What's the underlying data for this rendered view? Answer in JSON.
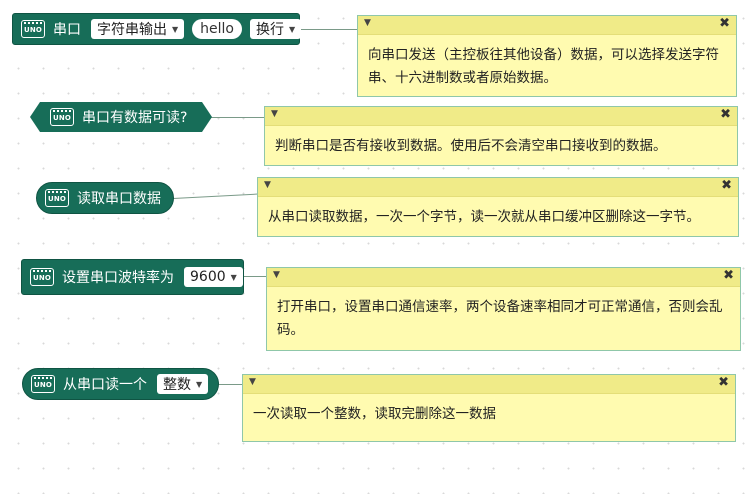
{
  "blocks": {
    "serial_write": {
      "label": "串口",
      "type_value": "字符串输出",
      "text_value": "hello",
      "ending_value": "换行"
    },
    "serial_available": {
      "label": "串口有数据可读?"
    },
    "serial_read": {
      "label": "读取串口数据"
    },
    "serial_begin": {
      "label": "设置串口波特率为",
      "baud_value": "9600"
    },
    "serial_read_number": {
      "label": "从串口读一个",
      "type_value": "整数"
    }
  },
  "board_badge": "UNO",
  "comments": [
    "向串口发送（主控板往其他设备）数据，可以选择发送字符串、十六进制数或者原始数据。",
    "判断串口是否有接收到数据。使用后不会清空串口接收到的数据。",
    "从串口读取数据，一次一个字节，读一次就从串口缓冲区删除这一字节。",
    "打开串口，设置串口通信速率，两个设备速率相同才可正常通信，否则会乱码。",
    "一次读取一个整数，读取完删除这一数据"
  ],
  "icons": {
    "dropdown": "▼",
    "close": "✖",
    "collapse": "▼"
  },
  "colors": {
    "block": "#176d58",
    "note_bg": "#fffbb0",
    "note_header": "#f0eb88"
  }
}
